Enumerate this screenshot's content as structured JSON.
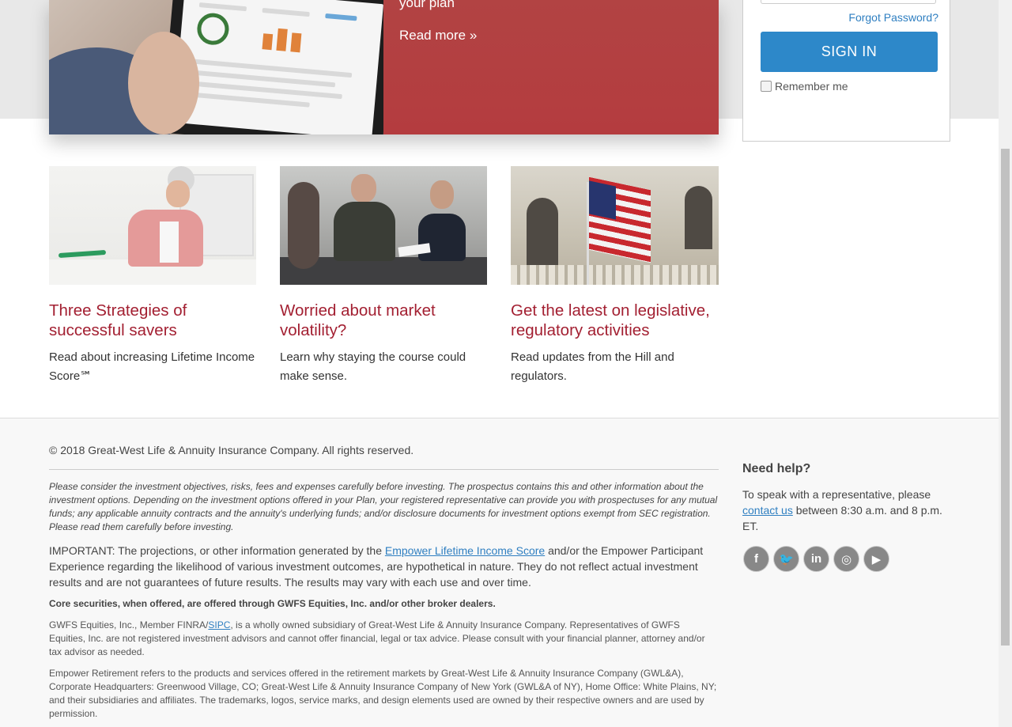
{
  "hero": {
    "subtitle": "your plan",
    "read_more": "Read more »"
  },
  "login": {
    "forgot_password": "Forgot Password?",
    "sign_in": "SIGN IN",
    "remember_me": "Remember me"
  },
  "cards": [
    {
      "title": "Three Strategies of successful savers",
      "text": "Read about increasing Lifetime Income Score℠"
    },
    {
      "title": "Worried about market volatility?",
      "text": "Learn why staying the course could make sense."
    },
    {
      "title": "Get the latest on legislative, regulatory activities",
      "text": "Read updates from the Hill and regulators."
    }
  ],
  "footer": {
    "copyright": "© 2018 Great-West Life & Annuity Insurance Company. All rights reserved.",
    "disclaimer": "Please consider the investment objectives, risks, fees and expenses carefully before investing. The prospectus contains this and other information about the investment options. Depending on the investment options offered in your Plan, your registered representative can provide you with prospectuses for any mutual funds; any applicable annuity contracts and the annuity's underlying funds; and/or disclosure documents for investment options exempt from SEC registration. Please read them carefully before investing.",
    "important_pre": "IMPORTANT: The projections, or other information generated by the ",
    "important_link": "Empower Lifetime Income Score",
    "important_post": " and/or the Empower Participant Experience regarding the likelihood of various investment outcomes, are hypothetical in nature. They do not reflect actual investment results and are not guarantees of future results. The results may vary with each use and over time.",
    "core": "Core securities, when offered, are offered through GWFS Equities, Inc. and/or other broker dealers.",
    "gwfs_pre": "GWFS Equities, Inc., Member FINRA/",
    "gwfs_link": "SIPC",
    "gwfs_post": ", is a wholly owned subsidiary of Great-West Life & Annuity Insurance Company. Representatives of GWFS Equities, Inc. are not registered investment advisors and cannot offer financial, legal or tax advice. Please consult with your financial planner, attorney and/or tax advisor as needed.",
    "empower": "Empower Retirement refers to the products and services offered in the retirement markets by Great-West Life & Annuity Insurance Company (GWL&A), Corporate Headquarters: Greenwood Village, CO; Great-West Life & Annuity Insurance Company of New York (GWL&A of NY), Home Office: White Plains, NY; and their subsidiaries and affiliates. The trademarks, logos, service marks, and design elements used are owned by their respective owners and are used by permission."
  },
  "help": {
    "title": "Need help?",
    "text_pre": "To speak with a representative, please ",
    "link": "contact us",
    "text_post": " between 8:30 a.m. and 8 p.m. ET."
  },
  "social": [
    {
      "icon": "facebook-icon",
      "glyph": "f"
    },
    {
      "icon": "twitter-icon",
      "glyph": "🐦"
    },
    {
      "icon": "linkedin-icon",
      "glyph": "in"
    },
    {
      "icon": "instagram-icon",
      "glyph": "◎"
    },
    {
      "icon": "youtube-icon",
      "glyph": "▶"
    }
  ]
}
